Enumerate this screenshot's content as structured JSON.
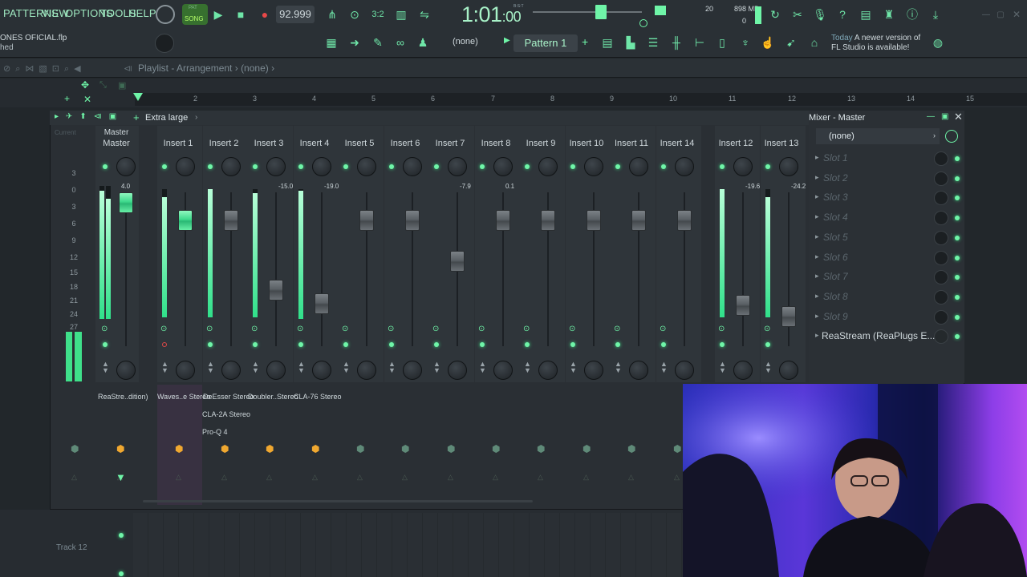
{
  "menu": [
    "PATTERNS",
    "VIEW",
    "OPTIONS",
    "TOOLS",
    "HELP"
  ],
  "transport": {
    "song_mode": "SONG",
    "pat_mode": "PAT",
    "tempo": "92.999",
    "time_main": "1:01",
    "time_sub": "00",
    "time_unit": "B:S:T",
    "cpu_num": "20",
    "memory": "898 MB",
    "memory_sub": "0"
  },
  "file": {
    "name": "ONES OFICIAL.flp",
    "status": "hed"
  },
  "toolbar2": {
    "channel_none": "(none)",
    "pattern": "Pattern 1",
    "news_label": "Today",
    "news_text": "A newer version of FL Studio is available!"
  },
  "playlist": {
    "title": "Playlist - Arrangement",
    "title_sub": "(none)",
    "ruler": [
      "2",
      "3",
      "4",
      "5",
      "6",
      "7",
      "8",
      "9",
      "10",
      "11",
      "12",
      "13",
      "14",
      "15"
    ],
    "track_label": "Track 12",
    "current_label": "Current"
  },
  "mixer": {
    "size_mode": "Extra large",
    "master": {
      "label_top": "Master",
      "label": "Master",
      "peak": "4.0",
      "route": "ReaStre..dition)"
    },
    "scale": [
      "3",
      "0",
      "3",
      "6",
      "9",
      "12",
      "15",
      "18",
      "21",
      "24",
      "27"
    ],
    "inserts": [
      {
        "label": "Insert 1",
        "peak": "",
        "route": "Waves..e Stereo"
      },
      {
        "label": "Insert 2",
        "peak": "",
        "route": "DeEsser Stereo"
      },
      {
        "label": "Insert 3",
        "peak": "-15.0",
        "route": "Doubler..Stereo"
      },
      {
        "label": "Insert 4",
        "peak": "-19.0",
        "route": "CLA-76 Stereo"
      },
      {
        "label": "Insert 5",
        "peak": "",
        "route": ""
      },
      {
        "label": "Insert 6",
        "peak": "",
        "route": ""
      },
      {
        "label": "Insert 7",
        "peak": "-7.9",
        "route": ""
      },
      {
        "label": "Insert 8",
        "peak": "0.1",
        "route": ""
      },
      {
        "label": "Insert 9",
        "peak": "",
        "route": ""
      },
      {
        "label": "Insert 10",
        "peak": "",
        "route": ""
      },
      {
        "label": "Insert 11",
        "peak": "",
        "route": ""
      },
      {
        "label": "Insert 14",
        "peak": "",
        "route": ""
      },
      {
        "label": "Insert 12",
        "peak": "-19.6",
        "route": ""
      },
      {
        "label": "Insert 13",
        "peak": "-24.2",
        "route": ""
      }
    ],
    "insert2_extra": [
      "CLA-2A Stereo",
      "Pro-Q 4"
    ]
  },
  "mixer_panel": {
    "title": "Mixer - Master",
    "input": "(none)",
    "slots": [
      "Slot 1",
      "Slot 2",
      "Slot 3",
      "Slot 4",
      "Slot 5",
      "Slot 6",
      "Slot 7",
      "Slot 8",
      "Slot 9"
    ],
    "plugin": "ReaStream (ReaPlugs E..."
  },
  "colors": {
    "accent": "#6ff5a8",
    "background": "#22272b",
    "orange": "#f0a830"
  }
}
